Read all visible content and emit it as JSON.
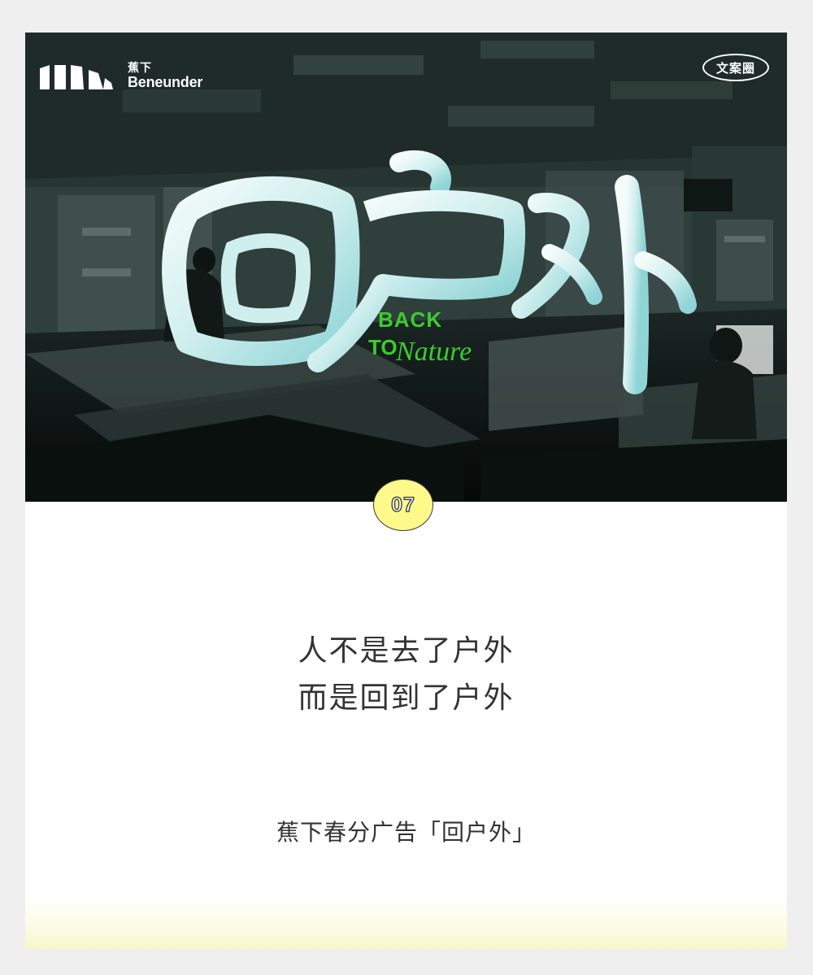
{
  "brand": {
    "name_cn": "蕉下",
    "name_en": "Beneunder",
    "logo_icon": "beneunder-bars-logo"
  },
  "tag_badge": "文案圈",
  "campaign": {
    "title_art": "回户外",
    "sub_line1": "BACK",
    "sub_line2": "TO",
    "sub_line3": "Nature"
  },
  "number_badge": "07",
  "headline": {
    "line1": "人不是去了户外",
    "line2": "而是回到了户外"
  },
  "caption": "蕉下春分广告「回户外」",
  "colors": {
    "background": "#efefef",
    "card": "#ffffff",
    "badge_fill": "#fdfa8b",
    "accent_green": "#3ccc2e",
    "text": "#333333"
  }
}
